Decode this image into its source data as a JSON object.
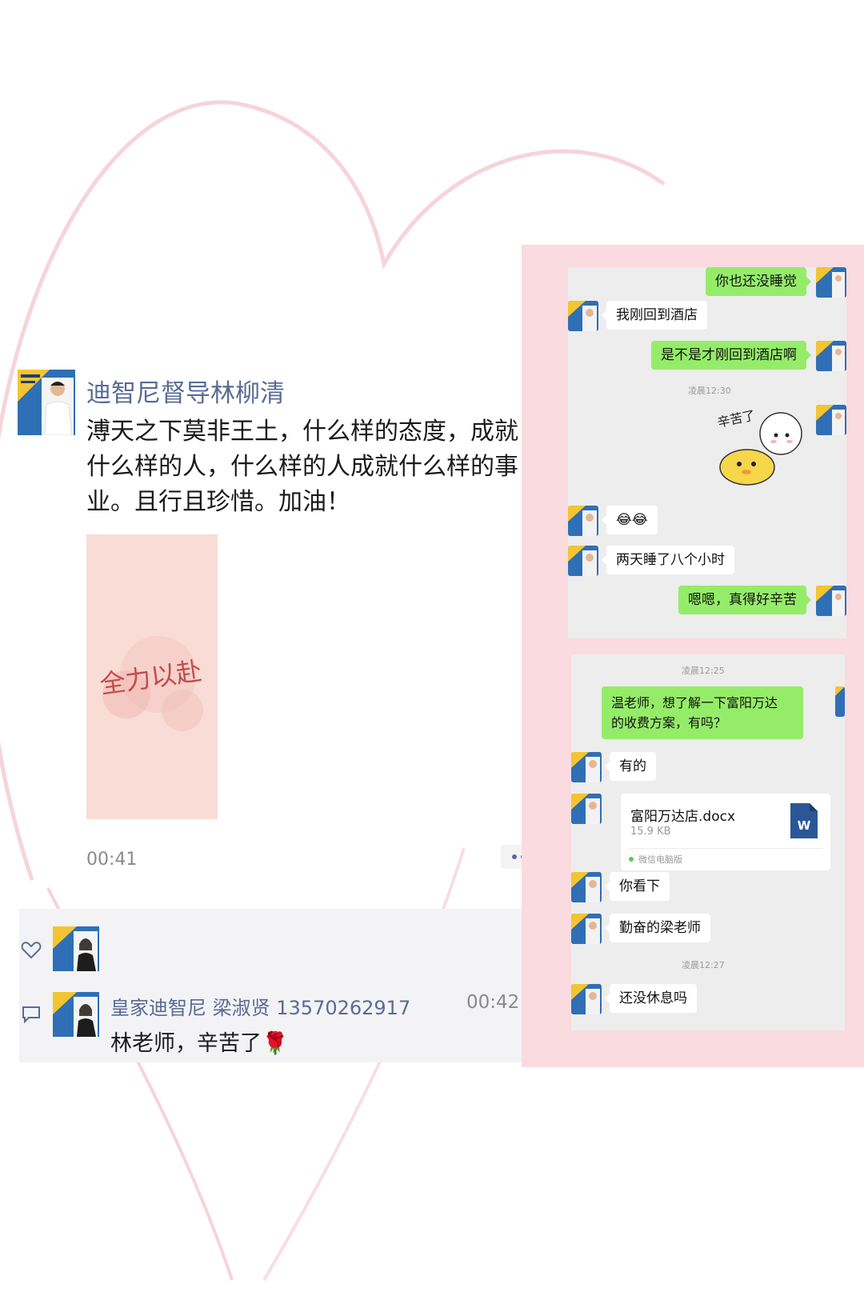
{
  "post": {
    "author": "迪智尼督导林柳清",
    "text": "溥天之下莫非王土，什么样的态度，成就什么样的人，什么样的人成就什么样的事业。且行且珍惜。加油！",
    "image_text": "全力以赴",
    "time": "00:41"
  },
  "comment": {
    "author": "皇家迪智尼 梁淑贤 13570262917",
    "time": "00:42",
    "text": "林老师，辛苦了🌹"
  },
  "chat_top": {
    "messages": [
      {
        "side": "right",
        "text": "你也还没睡觉"
      },
      {
        "side": "left",
        "text": "我刚回到酒店"
      },
      {
        "side": "right",
        "text": "是不是才刚回到酒店啊"
      },
      {
        "side": "left",
        "text": "😂😂"
      },
      {
        "side": "left",
        "text": "两天睡了八个小时"
      },
      {
        "side": "right",
        "text": "嗯嗯，真得好辛苦"
      }
    ],
    "timestamp": "凌晨12:30",
    "sticker_text": "辛苦了"
  },
  "chat_bottom": {
    "timestamp1": "凌晨12:25",
    "timestamp2": "凌晨12:27",
    "request_line1": "温老师，想了解一下富阳万达",
    "request_line2": "的收费方案，有吗？",
    "reply1": "有的",
    "file": {
      "name": "富阳万达店.docx",
      "size": "15.9 KB",
      "icon_letter": "W",
      "source": "微信电脑版"
    },
    "reply2": "你看下",
    "reply3": "勤奋的梁老师",
    "reply4": "还没休息吗"
  },
  "colors": {
    "accent": "#586b95",
    "bubble_green": "#95ec69",
    "frame_pink": "#fadbe0",
    "chat_bg": "#ededee"
  }
}
